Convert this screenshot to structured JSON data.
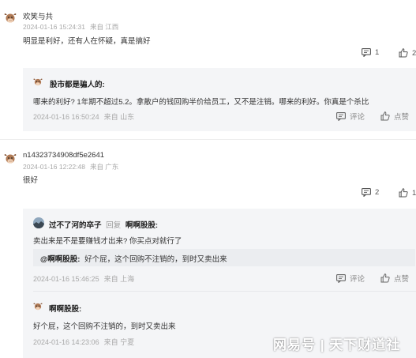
{
  "comments": [
    {
      "user": "欢笑与共",
      "time": "2024-01-16 15:24:31",
      "location": "来自 江西",
      "text": "明显是利好，还有人在怀疑，真是搞好",
      "replies_count": "1",
      "likes_count": "2",
      "reply": {
        "user": "股市都是骗人的:",
        "text": "哪来的利好? 1年期不超过5.2。拿散户的钱回购半价给员工，又不是注销。哪来的利好。你真是个杀比",
        "time": "2024-01-16 16:50:24",
        "location": "来自 山东",
        "comment_label": "评论",
        "like_label": "点赞"
      }
    },
    {
      "user": "n14323734908df5e2641",
      "time": "2024-01-16 12:22:48",
      "location": "来自 广东",
      "text": "很好",
      "replies_count": "2",
      "likes_count": "1",
      "reply1": {
        "user": "过不了河的卒子",
        "reply_word": "回复",
        "target": "啊啊股股:",
        "text": "卖出来是不是要赚钱才出来? 你买点对就行了",
        "quote_user": "@啊啊股股:",
        "quote_text": "好个屁，这个回购不注销的，到时又卖出来",
        "time": "2024-01-16 15:46:25",
        "location": "来自 上海",
        "comment_label": "评论",
        "like_label": "点赞"
      },
      "reply2": {
        "user": "啊啊股股:",
        "text": "好个屁，这个回购不注销的，到时又卖出来",
        "time": "2024-01-16 14:23:06",
        "location": "来自 宁夏"
      }
    }
  ],
  "watermark": "网易号 | 天下财道社",
  "icons": {
    "comment": "comment-icon",
    "like": "thumbs-up-icon",
    "avatar": "cow-avatar-icon"
  }
}
